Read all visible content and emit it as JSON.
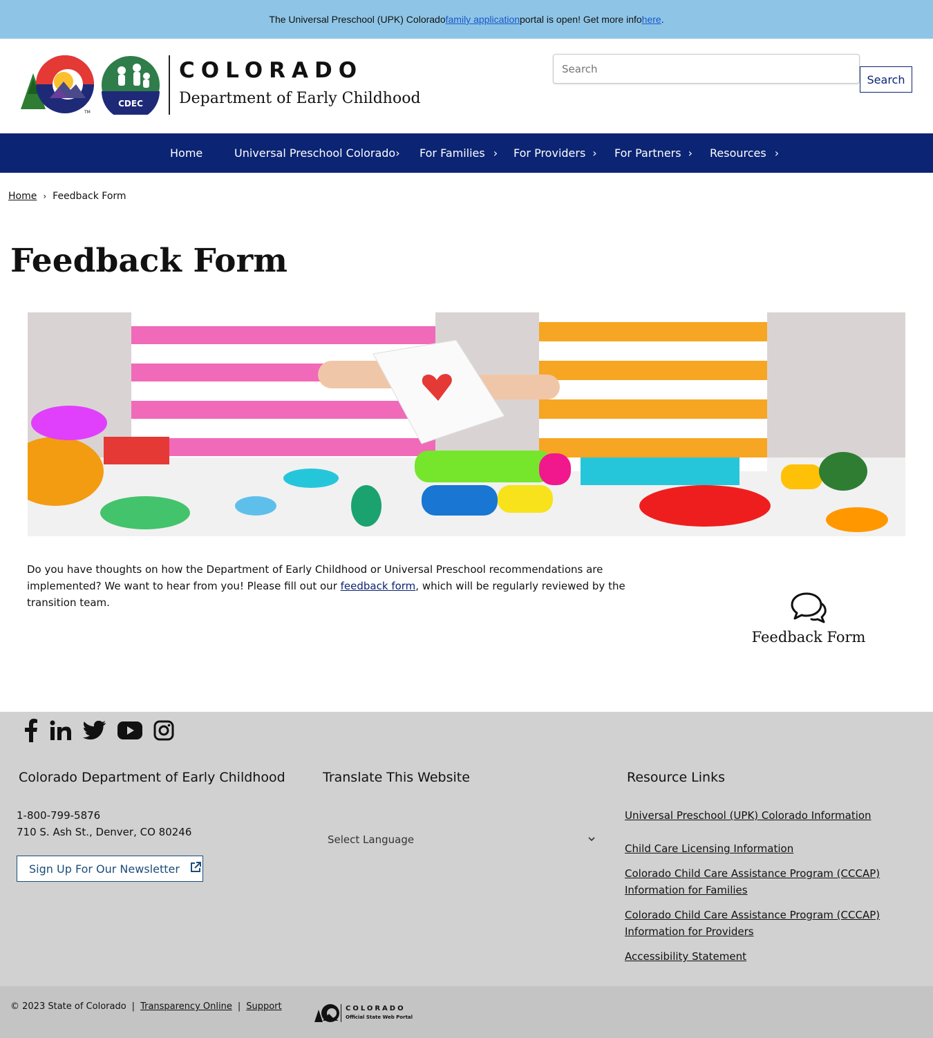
{
  "alert": {
    "text_before": "The Universal Preschool (UPK) Colorado ",
    "link1": "family application",
    "text_middle": " portal is open! Get more info ",
    "link2": "here",
    "text_after": "."
  },
  "header": {
    "logo_title": "COLORADO",
    "logo_subtitle": "Department of Early Childhood",
    "cdec_badge": "CDEC",
    "trademark": "TM",
    "search_placeholder": "Search",
    "search_button": "Search"
  },
  "nav": {
    "items": [
      {
        "label": "Home",
        "has_submenu": false
      },
      {
        "label": "Universal Preschool Colorado",
        "has_submenu": true
      },
      {
        "label": "For Families",
        "has_submenu": true
      },
      {
        "label": "For Providers",
        "has_submenu": true
      },
      {
        "label": "For Partners",
        "has_submenu": true
      },
      {
        "label": "Resources",
        "has_submenu": true
      }
    ]
  },
  "breadcrumb": {
    "home": "Home",
    "current": "Feedback Form"
  },
  "main": {
    "title": "Feedback Form",
    "intro_before": "Do you have thoughts on how the Department of Early Childhood or Universal Preschool recommendations are implemented? We want to hear from you! Please fill out our ",
    "intro_link": "feedback form",
    "intro_after": ", which will be regularly reviewed by the transition team.",
    "card_label": "Feedback Form",
    "card_icon": "comments-icon"
  },
  "footer": {
    "social": [
      "facebook-icon",
      "linkedin-icon",
      "twitter-icon",
      "youtube-icon",
      "instagram-icon"
    ],
    "org_title": "Colorado Department of Early Childhood",
    "phone": "1-800-799-5876",
    "address": "710 S. Ash St., Denver, CO 80246",
    "newsletter": "Sign Up For Our Newsletter",
    "translate_title": "Translate This Website",
    "language_select": "Select Language",
    "resources_title": "Resource Links",
    "resource_links": [
      "Universal Preschool (UPK) Colorado Information",
      "Child Care Licensing Information",
      "Colorado Child Care Assistance Program (CCCAP) Information for Families",
      "Colorado Child Care Assistance Program (CCCAP) Information for Providers",
      "Accessibility Statement"
    ]
  },
  "bottom": {
    "copyright": "© 2023 State of Colorado",
    "link1": "Transparency Online",
    "link2": "Support",
    "portal_name": "COLORADO",
    "portal_sub": "Official State Web Portal"
  },
  "colors": {
    "alert_bg": "#8ec5e6",
    "nav_bg": "#0b2474",
    "footer_bg": "#d1d1d1",
    "bottom_bg": "#c4c4c4"
  }
}
